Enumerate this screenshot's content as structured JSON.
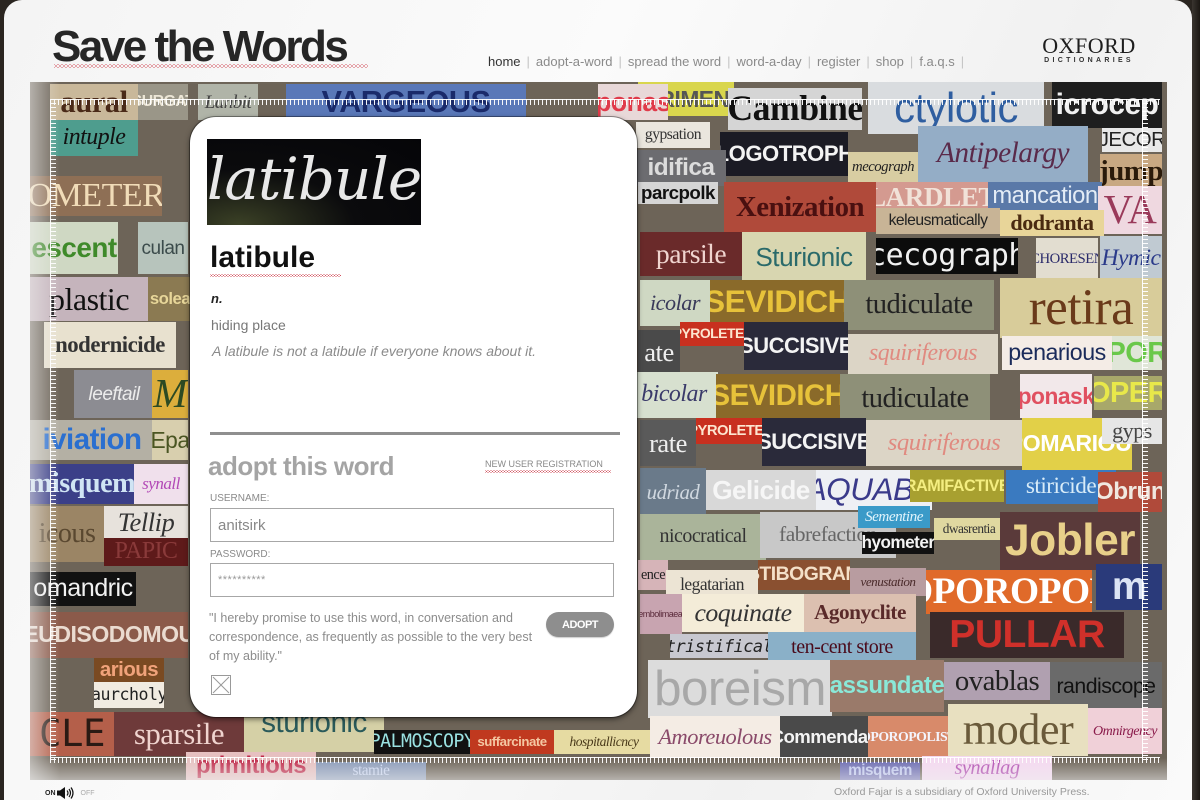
{
  "header": {
    "logo": "Save the Words",
    "nav": [
      {
        "label": "home",
        "active": true
      },
      {
        "label": "adopt-a-word",
        "active": false
      },
      {
        "label": "spread the word",
        "active": false
      },
      {
        "label": "word-a-day",
        "active": false
      },
      {
        "label": "register",
        "active": false
      },
      {
        "label": "shop",
        "active": false
      },
      {
        "label": "f.a.q.s",
        "active": false
      }
    ],
    "brand": {
      "name": "OXFORD",
      "subtitle": "DICTIONARIES"
    }
  },
  "word_card": {
    "image_word": "latibule",
    "word": "latibule",
    "part_of_speech": "n.",
    "definition": "hiding place",
    "example": "A latibule is not a latibule if everyone knows about it."
  },
  "adopt_form": {
    "heading": "adopt this word",
    "registration_link": "NEW USER REGISTRATION",
    "username_label": "USERNAME:",
    "username_value": "anitsirk",
    "password_label": "PASSWORD:",
    "password_value": "**********",
    "pledge": "\"I hereby promise to use this word, in conversation and correspondence,  as frequently as possible to the very best of my ability.\"",
    "adopt_button": "ADOPT",
    "pledge_checked": false
  },
  "footer": {
    "sound_on": "ON",
    "sound_off": "OFF",
    "credit": "Oxford Fajar is a subsidiary of Oxford University Press."
  },
  "colors": {
    "underline_squiggle": "#d2525e",
    "button": "#8e8e8e",
    "heading_grey": "#a4a4a4"
  },
  "collage_words": [
    {
      "text": "aural",
      "bg": "#c9b89a",
      "fg": "#4a2a18",
      "font": "serif",
      "style": "bold"
    },
    {
      "text": "SURGAT",
      "bg": "#9a9688",
      "fg": "#ece6d6",
      "font": "sans",
      "style": "bold"
    },
    {
      "text": "intuple",
      "bg": "#4e9d8e",
      "fg": "#111",
      "font": "serif",
      "style": "italic"
    },
    {
      "text": "OMETER",
      "bg": "#8e6f55",
      "fg": "#f1dcb8",
      "font": "serif",
      "style": ""
    },
    {
      "text": "escent",
      "bg": "#cfd8c3",
      "fg": "#3f8a2a",
      "font": "sans",
      "style": "bold"
    },
    {
      "text": "culan",
      "bg": "#b7c4bc",
      "fg": "#3b4b4b",
      "font": "sans",
      "style": ""
    },
    {
      "text": "plastic",
      "bg": "#c5b4bc",
      "fg": "#111",
      "font": "serif",
      "style": ""
    },
    {
      "text": "solea",
      "bg": "#8b7a52",
      "fg": "#e7d699",
      "font": "sans",
      "style": "bold"
    },
    {
      "text": "nodernicide",
      "bg": "#e8e1cf",
      "fg": "#333",
      "font": "serif",
      "style": "bold"
    },
    {
      "text": "leeftail",
      "bg": "#8c8c92",
      "fg": "#ececec",
      "font": "sans",
      "style": "italic"
    },
    {
      "text": "M",
      "bg": "#dcae3c",
      "fg": "#2c4a23",
      "font": "serif",
      "style": "italic"
    },
    {
      "text": "iviation",
      "bg": "#b4b0a4",
      "fg": "#2a6fd0",
      "font": "sans",
      "style": "bold"
    },
    {
      "text": "Epa",
      "bg": "#d8cfae",
      "fg": "#4a5522",
      "font": "sans",
      "style": ""
    },
    {
      "text": "misquem",
      "bg": "#3b3f88",
      "fg": "#d0e4f4",
      "font": "serif",
      "style": "bold"
    },
    {
      "text": "synall",
      "bg": "#f0e0ec",
      "fg": "#b248b6",
      "font": "serif",
      "style": "italic"
    },
    {
      "text": "icous",
      "bg": "#9b8565",
      "fg": "#5a4830",
      "font": "serif",
      "style": ""
    },
    {
      "text": "Tellip",
      "bg": "#e7e2dc",
      "fg": "#333",
      "font": "serif",
      "style": "italic"
    },
    {
      "text": "PAPIC",
      "bg": "#5e1a1a",
      "fg": "#8a3a3a",
      "font": "serif",
      "style": ""
    },
    {
      "text": "omandric",
      "bg": "#111",
      "fg": "#f2f2f2",
      "font": "sans",
      "style": ""
    },
    {
      "text": "SEUDISODOMOUS",
      "bg": "#8b5a4a",
      "fg": "#eadbd0",
      "font": "sans",
      "style": "bold"
    },
    {
      "text": "arious",
      "bg": "#7a4a22",
      "fg": "#f0a27a",
      "font": "sans",
      "style": "bold"
    },
    {
      "text": "aurcholy",
      "bg": "#f1ebe1",
      "fg": "#222",
      "font": "mono",
      "style": ""
    },
    {
      "text": "CLE",
      "bg": "#b45f4a",
      "fg": "#2a1a14",
      "font": "mono",
      "style": ""
    },
    {
      "text": "sparsile",
      "bg": "#6e3a3a",
      "fg": "#f0d4cf",
      "font": "serif",
      "style": ""
    },
    {
      "text": "sturionic",
      "bg": "#d5d0a6",
      "fg": "#2a5a5a",
      "font": "sans",
      "style": ""
    },
    {
      "text": "PALMOSCOPY",
      "bg": "#111",
      "fg": "#9ae2e2",
      "font": "mono",
      "style": ""
    },
    {
      "text": "suffarcinate",
      "bg": "#c0391f",
      "fg": "#f4c7a2",
      "font": "sans",
      "style": "bold"
    },
    {
      "text": "hospitallicncy",
      "bg": "#e6dba2",
      "fg": "#4a3a1a",
      "font": "serif",
      "style": "italic"
    },
    {
      "text": "PERIMENT",
      "bg": "#d9d64d",
      "fg": "#555",
      "font": "sans",
      "style": "bold"
    },
    {
      "text": "Cambine",
      "bg": "#d5d5d5",
      "fg": "#111",
      "font": "serif",
      "style": "bold"
    },
    {
      "text": "ctylotic",
      "bg": "#d9dcdf",
      "fg": "#2f5ea0",
      "font": "sans",
      "style": ""
    },
    {
      "text": "icrocep",
      "bg": "#1e1e1e",
      "fg": "#f1f1f1",
      "font": "sans",
      "style": "bold"
    },
    {
      "text": "gypsation",
      "bg": "#eae6de",
      "fg": "#333",
      "font": "serif",
      "style": ""
    },
    {
      "text": "ALOGOTROPHY",
      "bg": "#1b1b24",
      "fg": "#f3f3f3",
      "font": "sans",
      "style": "bold"
    },
    {
      "text": "Antipelargy",
      "bg": "#94adc6",
      "fg": "#5a2a4a",
      "font": "serif",
      "style": "italic"
    },
    {
      "text": "JECOR",
      "bg": "#e8e8e8",
      "fg": "#222",
      "font": "sans",
      "style": ""
    },
    {
      "text": "idifica",
      "bg": "#6c6c70",
      "fg": "#dcdcdc",
      "font": "sans",
      "style": "bold"
    },
    {
      "text": "mecograph",
      "bg": "#d8cda2",
      "fg": "#222",
      "font": "serif",
      "style": "italic"
    },
    {
      "text": "jump",
      "bg": "#c8a882",
      "fg": "#2a1a0a",
      "font": "serif",
      "style": "bold"
    },
    {
      "text": "parcpolk",
      "bg": "#d5d5d5",
      "fg": "#111",
      "font": "sans",
      "style": "bold"
    },
    {
      "text": "Xenization",
      "bg": "#b04a3a",
      "fg": "#4a1010",
      "font": "serif",
      "style": "bold"
    },
    {
      "text": "LARDLET",
      "bg": "#d49a90",
      "fg": "#f1e2d8",
      "font": "serif",
      "style": "bold"
    },
    {
      "text": "mancation",
      "bg": "#5a79a8",
      "fg": "#e3ecf6",
      "font": "sans",
      "style": ""
    },
    {
      "text": "VA",
      "bg": "#efd8e0",
      "fg": "#9a3a5a",
      "font": "serif",
      "style": ""
    },
    {
      "text": "keleusmatically",
      "bg": "#c8b496",
      "fg": "#222",
      "font": "sans",
      "style": ""
    },
    {
      "text": "dodranta",
      "bg": "#e8d599",
      "fg": "#4a2a10",
      "font": "serif",
      "style": "bold"
    },
    {
      "text": "parsile",
      "bg": "#6a2a2a",
      "fg": "#f0d4cf",
      "font": "serif",
      "style": ""
    },
    {
      "text": "Sturionic",
      "bg": "#d8d6b0",
      "fg": "#2a6a6a",
      "font": "sans",
      "style": ""
    },
    {
      "text": "cecograph",
      "bg": "#0c0c0c",
      "fg": "#f1f1f1",
      "font": "mono",
      "style": ""
    },
    {
      "text": "CHORESEN",
      "bg": "#e2ddd0",
      "fg": "#2a2a6a",
      "font": "serif",
      "style": ""
    },
    {
      "text": "Hymic",
      "bg": "#c0cad2",
      "fg": "#2a3a8a",
      "font": "serif",
      "style": "italic"
    },
    {
      "text": "icolar",
      "bg": "#cfd8c3",
      "fg": "#3a3a5a",
      "font": "serif",
      "style": "italic"
    },
    {
      "text": "SEVIDICH",
      "bg": "#8a6a2a",
      "fg": "#e7c23a",
      "font": "sans",
      "style": "bold"
    },
    {
      "text": "tudiculate",
      "bg": "#8e9078",
      "fg": "#222",
      "font": "serif",
      "style": ""
    },
    {
      "text": "retira",
      "bg": "#d8cc9a",
      "fg": "#6a3a1a",
      "font": "serif",
      "style": ""
    },
    {
      "text": "ate",
      "bg": "#4a4a4a",
      "fg": "#eee",
      "font": "serif",
      "style": ""
    },
    {
      "text": "PYROLETER",
      "bg": "#c8301f",
      "fg": "#fde6d0",
      "font": "sans",
      "style": "bold"
    },
    {
      "text": "SUCCISIVE",
      "bg": "#2a2a3a",
      "fg": "#f4f4f4",
      "font": "sans",
      "style": "bold"
    },
    {
      "text": "squiriferous",
      "bg": "#dcd5c6",
      "fg": "#e08a80",
      "font": "serif",
      "style": "italic"
    },
    {
      "text": "penarious",
      "bg": "#f4ece6",
      "fg": "#1a2a5a",
      "font": "sans",
      "style": ""
    },
    {
      "text": "POR",
      "bg": "#e0e6d8",
      "fg": "#6ac84a",
      "font": "sans",
      "style": "bold"
    },
    {
      "text": "bicolar",
      "bg": "#d7e0cf",
      "fg": "#3a3a6a",
      "font": "serif",
      "style": "italic"
    },
    {
      "text": "SEVIDICH",
      "bg": "#8a6a2a",
      "fg": "#e7c23a",
      "font": "sans",
      "style": "bold"
    },
    {
      "text": "tudiculate",
      "bg": "#8e9078",
      "fg": "#222",
      "font": "serif",
      "style": ""
    },
    {
      "text": "ponask",
      "bg": "#f2e8ea",
      "fg": "#e05060",
      "font": "sans",
      "style": "bold"
    },
    {
      "text": "OPER",
      "bg": "#a8a86a",
      "fg": "#e8e84a",
      "font": "sans",
      "style": "bold"
    },
    {
      "text": "rate",
      "bg": "#5a5a5a",
      "fg": "#eee",
      "font": "serif",
      "style": ""
    },
    {
      "text": "PYROLETER",
      "bg": "#c8301f",
      "fg": "#fde6d0",
      "font": "sans",
      "style": "bold"
    },
    {
      "text": "SUCCISIVE",
      "bg": "#2a2a3a",
      "fg": "#f4f4f4",
      "font": "sans",
      "style": "bold"
    },
    {
      "text": "squiriferous",
      "bg": "#dcd5c6",
      "fg": "#e08a80",
      "font": "serif",
      "style": "italic"
    },
    {
      "text": "POMARIOUS",
      "bg": "#e2d048",
      "fg": "#fff",
      "font": "sans",
      "style": "bold"
    },
    {
      "text": "gyps",
      "bg": "#e6e6e6",
      "fg": "#444",
      "font": "serif",
      "style": ""
    },
    {
      "text": "udriad",
      "bg": "#6a7a8a",
      "fg": "#d0d8e0",
      "font": "serif",
      "style": "italic"
    },
    {
      "text": "Gelicide",
      "bg": "#d8d8d8",
      "fg": "#f6f6f6",
      "font": "sans",
      "style": "bold"
    },
    {
      "text": "AQUABIB",
      "bg": "#eef0f4",
      "fg": "#3a3a8a",
      "font": "sans",
      "style": "italic"
    },
    {
      "text": "RAMIFACTIVE",
      "bg": "#a8a030",
      "fg": "#f4ee80",
      "font": "sans",
      "style": "bold"
    },
    {
      "text": "stiricide",
      "bg": "#3a7ac0",
      "fg": "#d8ecf8",
      "font": "serif",
      "style": ""
    },
    {
      "text": "Obrun",
      "bg": "#b04a3a",
      "fg": "#f0e8e0",
      "font": "sans",
      "style": "bold"
    },
    {
      "text": "nicocratical",
      "bg": "#aab49a",
      "fg": "#333",
      "font": "serif",
      "style": ""
    },
    {
      "text": "fabrefaction",
      "bg": "#c8c8c8",
      "fg": "#666",
      "font": "serif",
      "style": ""
    },
    {
      "text": "Sementine",
      "bg": "#3a9ac8",
      "fg": "#e0f4fc",
      "font": "serif",
      "style": "italic"
    },
    {
      "text": "hyometer",
      "bg": "#111",
      "fg": "#f4f4f4",
      "font": "sans",
      "style": "bold"
    },
    {
      "text": "dwasrentia",
      "bg": "#e0d8a0",
      "fg": "#333",
      "font": "serif",
      "style": ""
    },
    {
      "text": "Jobler",
      "bg": "#5a3a3a",
      "fg": "#e8d08a",
      "font": "sans",
      "style": "bold"
    },
    {
      "text": "ence",
      "bg": "#d6b4b8",
      "fg": "#222",
      "font": "serif",
      "style": ""
    },
    {
      "text": "legatarian",
      "bg": "#ece4d4",
      "fg": "#333",
      "font": "serif",
      "style": ""
    },
    {
      "text": "STIBOGRAM",
      "bg": "#8a5030",
      "fg": "#f4e0c8",
      "font": "sans",
      "style": "bold"
    },
    {
      "text": "venustation",
      "bg": "#b89ca0",
      "fg": "#4a2a2a",
      "font": "serif",
      "style": "italic"
    },
    {
      "text": "OPOROPOL",
      "bg": "#e06a2a",
      "fg": "#fff",
      "font": "serif",
      "style": "bold"
    },
    {
      "text": "m",
      "bg": "#2a3a7a",
      "fg": "#dce4f4",
      "font": "sans",
      "style": "bold"
    },
    {
      "text": "embolimaeal",
      "bg": "#c8a4b0",
      "fg": "#5a2a3a",
      "font": "sans",
      "style": ""
    },
    {
      "text": "coquinate",
      "bg": "#f4ecd8",
      "fg": "#333",
      "font": "serif",
      "style": "italic"
    },
    {
      "text": "Agonyclite",
      "bg": "#dcc0b0",
      "fg": "#5a2a2a",
      "font": "serif",
      "style": "bold"
    },
    {
      "text": "PULLAR",
      "bg": "#3a2a2a",
      "fg": "#d0302a",
      "font": "sans",
      "style": "bold"
    },
    {
      "text": "tristifical",
      "bg": "#c8c8d0",
      "fg": "#222",
      "font": "mono",
      "style": "italic"
    },
    {
      "text": "ten-cent store",
      "bg": "#8ab0c8",
      "fg": "#4a0a1a",
      "font": "serif",
      "style": ""
    },
    {
      "text": "boreism",
      "bg": "#dcdcdc",
      "fg": "#a8a8a8",
      "font": "sans",
      "style": ""
    },
    {
      "text": "assundate",
      "bg": "#9a7a6a",
      "fg": "#8ae8d8",
      "font": "sans",
      "style": "bold"
    },
    {
      "text": "ovablas",
      "bg": "#b0a0b0",
      "fg": "#222",
      "font": "serif",
      "style": ""
    },
    {
      "text": "randiscope",
      "bg": "#6a6a6a",
      "fg": "#111",
      "font": "sans",
      "style": ""
    },
    {
      "text": "moder",
      "bg": "#e8e0c0",
      "fg": "#6a5a3a",
      "font": "serif",
      "style": ""
    },
    {
      "text": "Omnirgency",
      "bg": "#f0d0d8",
      "fg": "#8a1a4a",
      "font": "serif",
      "style": "italic"
    },
    {
      "text": "Amoreuolous",
      "bg": "#f4ece4",
      "fg": "#8a4a6a",
      "font": "serif",
      "style": "italic"
    },
    {
      "text": "Commendas",
      "bg": "#4a4a4a",
      "fg": "#f4f4f4",
      "font": "sans",
      "style": "bold"
    },
    {
      "text": "OPOROPOLIST",
      "bg": "#d88a6a",
      "fg": "#f4f4fc",
      "font": "serif",
      "style": "bold"
    },
    {
      "text": "primitious",
      "bg": "#e6c0c0",
      "fg": "#c02a4a",
      "font": "sans",
      "style": "bold"
    },
    {
      "text": "stamie",
      "bg": "#8a9ab8",
      "fg": "#c8d4f0",
      "font": "serif",
      "style": ""
    },
    {
      "text": "misquem",
      "bg": "#6a6ab0",
      "fg": "#c0c8f0",
      "font": "sans",
      "style": "bold"
    },
    {
      "text": "synallag",
      "bg": "#f4d8f0",
      "fg": "#b048b0",
      "font": "serif",
      "style": "italic"
    },
    {
      "text": "ponas",
      "bg": "#e8d8d8",
      "fg": "#e03a4a",
      "font": "sans",
      "style": "bold"
    },
    {
      "text": "Lanbit",
      "bg": "#b0b4a8",
      "fg": "#444",
      "font": "serif",
      "style": "italic"
    },
    {
      "text": "VARGEOUS",
      "bg": "#5a78b8",
      "fg": "#1a2a6a",
      "font": "sans",
      "style": "bold"
    }
  ]
}
